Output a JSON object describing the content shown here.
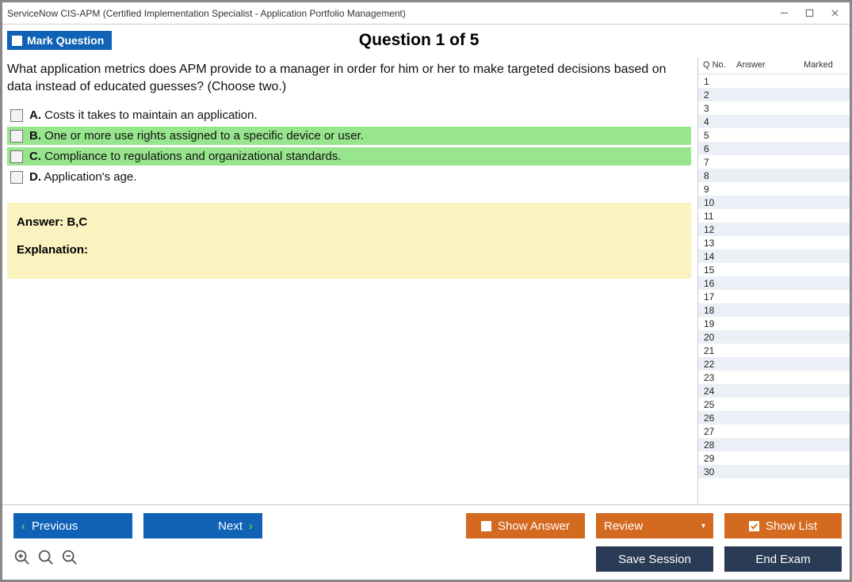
{
  "window": {
    "title": "ServiceNow CIS-APM (Certified Implementation Specialist - Application Portfolio Management)"
  },
  "toolbar": {
    "mark_question_label": "Mark Question",
    "question_heading": "Question 1 of 5"
  },
  "question": {
    "text": "What application metrics does APM provide to a manager in order for him or her to make targeted decisions based on data instead of educated guesses? (Choose two.)",
    "options": [
      {
        "letter": "A.",
        "text": "Costs it takes to maintain an application.",
        "selected": false
      },
      {
        "letter": "B.",
        "text": "One or more use rights assigned to a specific device or user.",
        "selected": true
      },
      {
        "letter": "C.",
        "text": "Compliance to regulations and organizational standards.",
        "selected": true
      },
      {
        "letter": "D.",
        "text": "Application's age.",
        "selected": false
      }
    ],
    "answer_label": "Answer: B,C",
    "explanation_label": "Explanation:",
    "explanation_text": ""
  },
  "sidebar": {
    "headers": {
      "qno": "Q No.",
      "answer": "Answer",
      "marked": "Marked"
    },
    "rows": [
      1,
      2,
      3,
      4,
      5,
      6,
      7,
      8,
      9,
      10,
      11,
      12,
      13,
      14,
      15,
      16,
      17,
      18,
      19,
      20,
      21,
      22,
      23,
      24,
      25,
      26,
      27,
      28,
      29,
      30
    ]
  },
  "footer": {
    "previous": "Previous",
    "next": "Next",
    "show_answer": "Show Answer",
    "review": "Review",
    "show_list": "Show List",
    "save_session": "Save Session",
    "end_exam": "End Exam"
  }
}
